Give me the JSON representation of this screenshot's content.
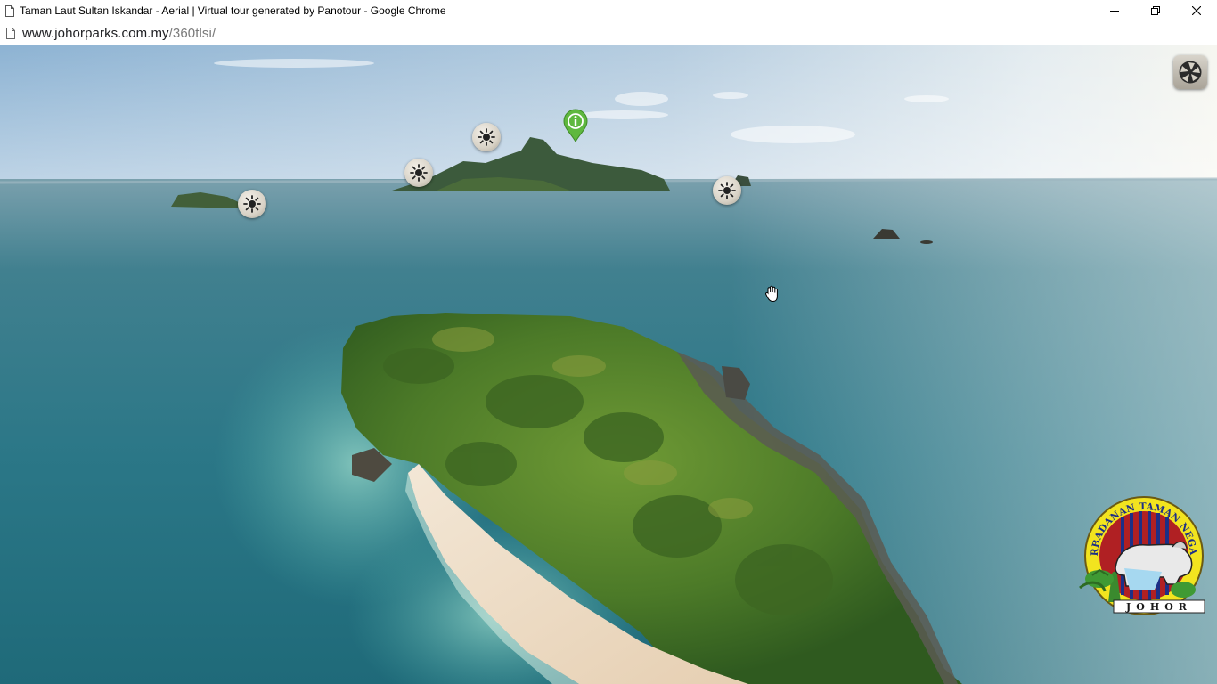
{
  "window": {
    "title": "Taman Laut Sultan Iskandar - Aerial | Virtual tour generated by Panotour - Google Chrome",
    "controls": {
      "minimize": "minimize-icon",
      "restore": "restore-icon",
      "close": "close-icon"
    }
  },
  "address": {
    "host": "www.johorparks.com.my",
    "path": "/360tlsi/"
  },
  "viewer": {
    "hotspots": [
      {
        "name": "hotspot-aerial-1",
        "icon": "sun-burst-icon"
      },
      {
        "name": "hotspot-aerial-2",
        "icon": "sun-burst-icon"
      },
      {
        "name": "hotspot-aerial-3",
        "icon": "sun-burst-icon"
      },
      {
        "name": "hotspot-aerial-4",
        "icon": "sun-burst-icon"
      }
    ],
    "info_pin": {
      "icon": "info-pin-icon",
      "color": "#5fb83f"
    },
    "camera_button": {
      "icon": "camera-aperture-icon"
    },
    "logo": {
      "arc_text": "PERBADANAN TAMAN NEGARA",
      "state_text": "JOHOR"
    }
  },
  "colors": {
    "sky_top": "#8fb6d6",
    "sea": "#2f7f8f",
    "foliage": "#4f7f2a",
    "sand": "#eedcc4"
  }
}
